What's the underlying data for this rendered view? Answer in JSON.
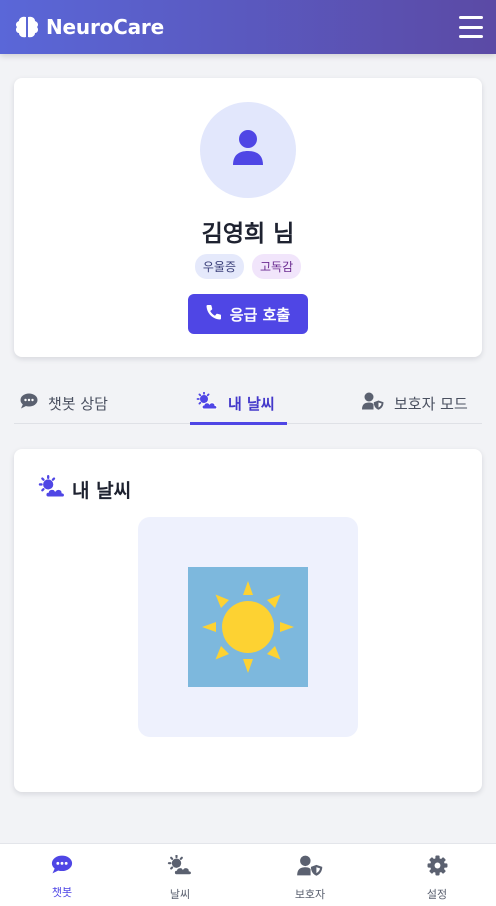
{
  "header": {
    "brand": "NeuroCare",
    "brand_icon": "brain-icon",
    "menu_icon": "hamburger-menu-icon"
  },
  "profile": {
    "name": "김영희 님",
    "avatar_icon": "user-icon",
    "tags": [
      "우울증",
      "고독감"
    ],
    "emergency_button": "응급 호출",
    "emergency_icon": "phone-icon"
  },
  "tabs": [
    {
      "label": "챗봇 상담",
      "icon": "chat-bubble-icon",
      "active": false
    },
    {
      "label": "내 날씨",
      "icon": "sun-cloud-icon",
      "active": true
    },
    {
      "label": "보호자 모드",
      "icon": "user-shield-icon",
      "active": false
    }
  ],
  "weather": {
    "title": "내 날씨",
    "title_icon": "sun-cloud-icon",
    "condition_icon": "sun-icon"
  },
  "bottom_nav": [
    {
      "label": "챗봇",
      "icon": "chat-bubble-icon",
      "active": true
    },
    {
      "label": "날씨",
      "icon": "sun-cloud-icon",
      "active": false
    },
    {
      "label": "보호자",
      "icon": "user-shield-icon",
      "active": false
    },
    {
      "label": "설정",
      "icon": "gear-icon",
      "active": false
    }
  ],
  "colors": {
    "primary": "#4f46e5",
    "header_start": "#5a67d8",
    "header_end": "#5b4aa5",
    "sun": "#fdd232",
    "sky": "#7db8dd"
  }
}
